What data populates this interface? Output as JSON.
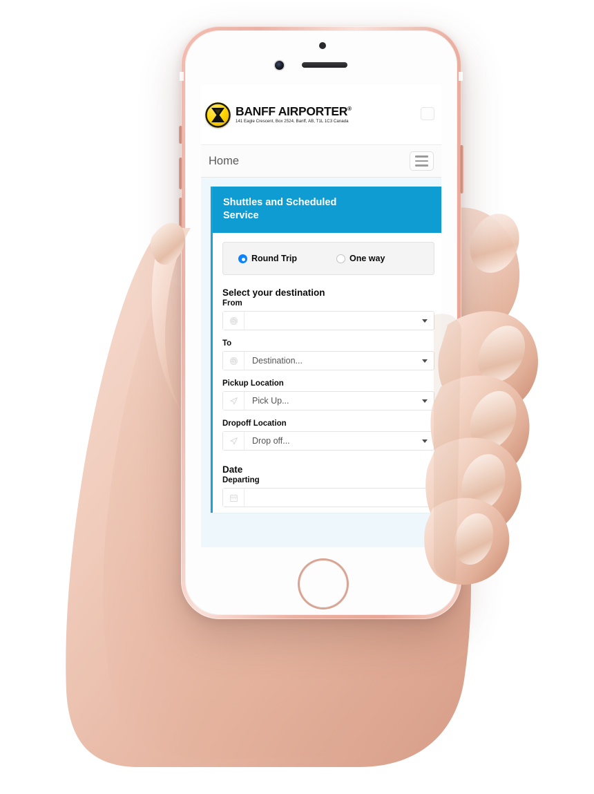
{
  "device": {
    "type": "smartphone-mockup",
    "model_color": "rose-gold",
    "frame_color": "#eeb0a3",
    "home_button_ring": "#d8a493"
  },
  "screen": {
    "background": "#eef7fc",
    "site_header": {
      "logo": {
        "icon_name": "banff-airporter-logo",
        "mark_bg": "#fdd808",
        "title": "BANFF AIRPORTER",
        "registered_mark": "®",
        "subtitle": "141 Eagle Crescent, Box 2524, Banff, AB, T1L 1C3 Canada"
      },
      "corner_box_label": ""
    },
    "navbar": {
      "brand": "Home",
      "toggle_name": "hamburger-menu"
    },
    "booking_card": {
      "accent_color": "#0f9cd3",
      "header_title": "Shuttles and Scheduled\nService",
      "header_line1": "Shuttles and Scheduled",
      "header_line2": "Service",
      "trip_type": {
        "options": [
          {
            "label": "Round Trip",
            "selected": true
          },
          {
            "label": "One way",
            "selected": false
          }
        ],
        "selected_color": "#0a84ff"
      },
      "destination_section": {
        "title": "Select your destination",
        "fields": [
          {
            "label": "From",
            "icon": "globe-icon",
            "value": "",
            "placeholder": ""
          },
          {
            "label": "To",
            "icon": "globe-icon",
            "value": "Destination...",
            "placeholder": "Destination..."
          },
          {
            "label": "Pickup Location",
            "icon": "navigation-arrow-icon",
            "value": "Pick Up...",
            "placeholder": "Pick Up..."
          },
          {
            "label": "Dropoff Location",
            "icon": "navigation-arrow-icon",
            "value": "Drop off...",
            "placeholder": "Drop off..."
          }
        ]
      },
      "date_section": {
        "title": "Date",
        "fields": [
          {
            "label": "Departing",
            "icon": "calendar-icon",
            "value": "",
            "placeholder": ""
          }
        ]
      }
    }
  }
}
